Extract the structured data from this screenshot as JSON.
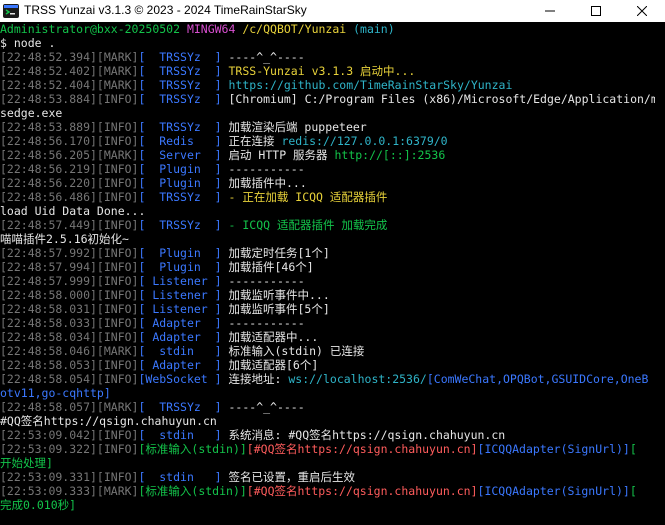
{
  "window": {
    "title": "TRSS Yunzai v3.1.3 © 2023 - 2024 TimeRainStarSky",
    "minimize_label": "minimize",
    "maximize_label": "maximize",
    "close_label": "close"
  },
  "colors": {
    "grey": "#767676",
    "white": "#e6e6e6",
    "green": "#13c34a",
    "yellow": "#e8d23a",
    "magenta": "#d84fd0",
    "cyan": "#2fb4c8",
    "blue": "#3b78ff",
    "pink": "#ff5c5c"
  },
  "lines": [
    [
      {
        "t": "Administrator@bxx-20250502 ",
        "c": "green"
      },
      {
        "t": "MINGW64 ",
        "c": "magenta"
      },
      {
        "t": "/c/QQBOT/Yunzai ",
        "c": "yellow"
      },
      {
        "t": "(main)",
        "c": "cyan"
      }
    ],
    [
      {
        "t": "$ node .",
        "c": "white"
      }
    ],
    [
      {
        "t": "[22:48:52.394][MARK]",
        "c": "grey"
      },
      {
        "t": "[  TRSSYz  ] ",
        "c": "blue"
      },
      {
        "t": "----^_^----",
        "c": "white"
      }
    ],
    [
      {
        "t": "[22:48:52.402][MARK]",
        "c": "grey"
      },
      {
        "t": "[  TRSSYz  ] ",
        "c": "blue"
      },
      {
        "t": "TRSS-Yunzai v3.1.3 启动中...",
        "c": "yellow"
      }
    ],
    [
      {
        "t": "[22:48:52.404][MARK]",
        "c": "grey"
      },
      {
        "t": "[  TRSSYz  ] ",
        "c": "blue"
      },
      {
        "t": "https://github.com/TimeRainStarSky/Yunzai",
        "c": "cyan"
      }
    ],
    [
      {
        "t": "[22:48:53.884][INFO]",
        "c": "grey"
      },
      {
        "t": "[  TRSSYz  ] ",
        "c": "blue"
      },
      {
        "t": "[Chromium] C:/Program Files (x86)/Microsoft/Edge/Application/m",
        "c": "white"
      }
    ],
    [
      {
        "t": "sedge.exe",
        "c": "white"
      }
    ],
    [
      {
        "t": "[22:48:53.889][INFO]",
        "c": "grey"
      },
      {
        "t": "[  TRSSYz  ] ",
        "c": "blue"
      },
      {
        "t": "加载渲染后端 puppeteer",
        "c": "white"
      }
    ],
    [
      {
        "t": "[22:48:56.170][INFO]",
        "c": "grey"
      },
      {
        "t": "[  Redis   ] ",
        "c": "blue"
      },
      {
        "t": "正在连接 ",
        "c": "white"
      },
      {
        "t": "redis://127.0.0.1:6379/0",
        "c": "cyan"
      }
    ],
    [
      {
        "t": "[22:48:56.205][MARK]",
        "c": "grey"
      },
      {
        "t": "[  Server  ] ",
        "c": "blue"
      },
      {
        "t": "启动 HTTP 服务器 ",
        "c": "white"
      },
      {
        "t": "http://[::]:2536",
        "c": "green"
      }
    ],
    [
      {
        "t": "[22:48:56.219][INFO]",
        "c": "grey"
      },
      {
        "t": "[  Plugin  ] ",
        "c": "blue"
      },
      {
        "t": "-----------",
        "c": "white"
      }
    ],
    [
      {
        "t": "[22:48:56.220][INFO]",
        "c": "grey"
      },
      {
        "t": "[  Plugin  ] ",
        "c": "blue"
      },
      {
        "t": "加载插件中...",
        "c": "white"
      }
    ],
    [
      {
        "t": "[22:48:56.486][INFO]",
        "c": "grey"
      },
      {
        "t": "[  TRSSYz  ] ",
        "c": "blue"
      },
      {
        "t": "- 正在加载 ICQQ 适配器插件",
        "c": "yellow"
      }
    ],
    [
      {
        "t": "load Uid Data Done...",
        "c": "white"
      }
    ],
    [
      {
        "t": "[22:48:57.449][INFO]",
        "c": "grey"
      },
      {
        "t": "[  TRSSYz  ] ",
        "c": "blue"
      },
      {
        "t": "- ICQQ 适配器插件 加载完成",
        "c": "green"
      }
    ],
    [
      {
        "t": "喵喵插件2.5.16初始化~",
        "c": "white"
      }
    ],
    [
      {
        "t": "[22:48:57.992][INFO]",
        "c": "grey"
      },
      {
        "t": "[  Plugin  ] ",
        "c": "blue"
      },
      {
        "t": "加载定时任务[1个]",
        "c": "white"
      }
    ],
    [
      {
        "t": "[22:48:57.994][INFO]",
        "c": "grey"
      },
      {
        "t": "[  Plugin  ] ",
        "c": "blue"
      },
      {
        "t": "加载插件[46个]",
        "c": "white"
      }
    ],
    [
      {
        "t": "[22:48:57.999][INFO]",
        "c": "grey"
      },
      {
        "t": "[ Listener ] ",
        "c": "blue"
      },
      {
        "t": "-----------",
        "c": "white"
      }
    ],
    [
      {
        "t": "[22:48:58.000][INFO]",
        "c": "grey"
      },
      {
        "t": "[ Listener ] ",
        "c": "blue"
      },
      {
        "t": "加载监听事件中...",
        "c": "white"
      }
    ],
    [
      {
        "t": "[22:48:58.031][INFO]",
        "c": "grey"
      },
      {
        "t": "[ Listener ] ",
        "c": "blue"
      },
      {
        "t": "加载监听事件[5个]",
        "c": "white"
      }
    ],
    [
      {
        "t": "[22:48:58.033][INFO]",
        "c": "grey"
      },
      {
        "t": "[ Adapter  ] ",
        "c": "blue"
      },
      {
        "t": "-----------",
        "c": "white"
      }
    ],
    [
      {
        "t": "[22:48:58.034][INFO]",
        "c": "grey"
      },
      {
        "t": "[ Adapter  ] ",
        "c": "blue"
      },
      {
        "t": "加载适配器中...",
        "c": "white"
      }
    ],
    [
      {
        "t": "[22:48:58.046][MARK]",
        "c": "grey"
      },
      {
        "t": "[  stdin   ] ",
        "c": "blue"
      },
      {
        "t": "标准输入(stdin) 已连接",
        "c": "white"
      }
    ],
    [
      {
        "t": "[22:48:58.053][INFO]",
        "c": "grey"
      },
      {
        "t": "[ Adapter  ] ",
        "c": "blue"
      },
      {
        "t": "加载适配器[6个]",
        "c": "white"
      }
    ],
    [
      {
        "t": "[22:48:58.054][INFO]",
        "c": "grey"
      },
      {
        "t": "[WebSocket ] ",
        "c": "blue"
      },
      {
        "t": "连接地址: ",
        "c": "white"
      },
      {
        "t": "ws://localhost:2536/",
        "c": "cyan"
      },
      {
        "t": "[ComWeChat,OPQBot,GSUIDCore,OneB",
        "c": "blue"
      }
    ],
    [
      {
        "t": "otv11,go-cqhttp]",
        "c": "blue"
      }
    ],
    [
      {
        "t": "[22:48:58.057][MARK]",
        "c": "grey"
      },
      {
        "t": "[  TRSSYz  ] ",
        "c": "blue"
      },
      {
        "t": "----^_^----",
        "c": "white"
      }
    ],
    [
      {
        "t": "#QQ签名https://qsign.chahuyun.cn",
        "c": "white"
      }
    ],
    [
      {
        "t": "[22:53:09.042][INFO]",
        "c": "grey"
      },
      {
        "t": "[  stdin   ] ",
        "c": "blue"
      },
      {
        "t": "系统消息: #QQ签名https://qsign.chahuyun.cn",
        "c": "white"
      }
    ],
    [
      {
        "t": "[22:53:09.322][INFO]",
        "c": "grey"
      },
      {
        "t": "[标准输入(stdin)]",
        "c": "green"
      },
      {
        "t": "[#QQ签名https://qsign.chahuyun.cn]",
        "c": "pink"
      },
      {
        "t": "[ICQQAdapter(SignUrl)]",
        "c": "blue"
      },
      {
        "t": "[",
        "c": "green"
      }
    ],
    [
      {
        "t": "开始处理]",
        "c": "green"
      }
    ],
    [
      {
        "t": "[22:53:09.331][INFO]",
        "c": "grey"
      },
      {
        "t": "[  stdin   ] ",
        "c": "blue"
      },
      {
        "t": "签名已设置，重启后生效",
        "c": "white"
      }
    ],
    [
      {
        "t": "[22:53:09.333][MARK]",
        "c": "grey"
      },
      {
        "t": "[标准输入(stdin)]",
        "c": "green"
      },
      {
        "t": "[#QQ签名https://qsign.chahuyun.cn]",
        "c": "pink"
      },
      {
        "t": "[ICQQAdapter(SignUrl)]",
        "c": "blue"
      },
      {
        "t": "[",
        "c": "green"
      }
    ],
    [
      {
        "t": "完成0.010秒]",
        "c": "green"
      }
    ]
  ]
}
